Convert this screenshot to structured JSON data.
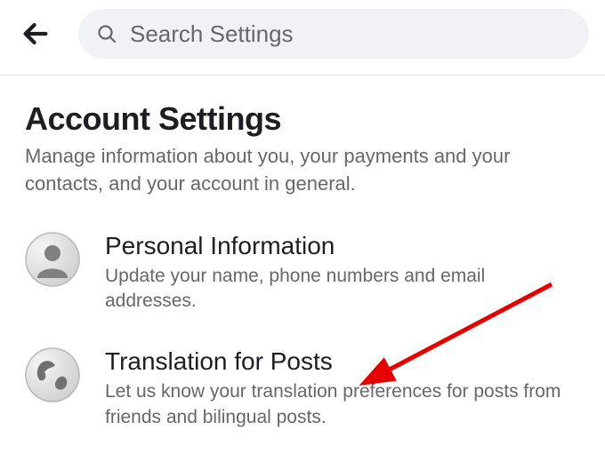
{
  "header": {
    "search_placeholder": "Search Settings"
  },
  "page": {
    "title": "Account Settings",
    "subtitle": "Manage information about you, your payments and your contacts, and your account in general."
  },
  "items": [
    {
      "icon": "person-icon",
      "title": "Personal Information",
      "subtitle": "Update your name, phone numbers and email addresses."
    },
    {
      "icon": "globe-icon",
      "title": "Translation for Posts",
      "subtitle": "Let us know your translation preferences for posts from friends and bilingual posts."
    }
  ],
  "annotation": {
    "arrow_color": "#e60000",
    "target": "translation-for-posts"
  }
}
